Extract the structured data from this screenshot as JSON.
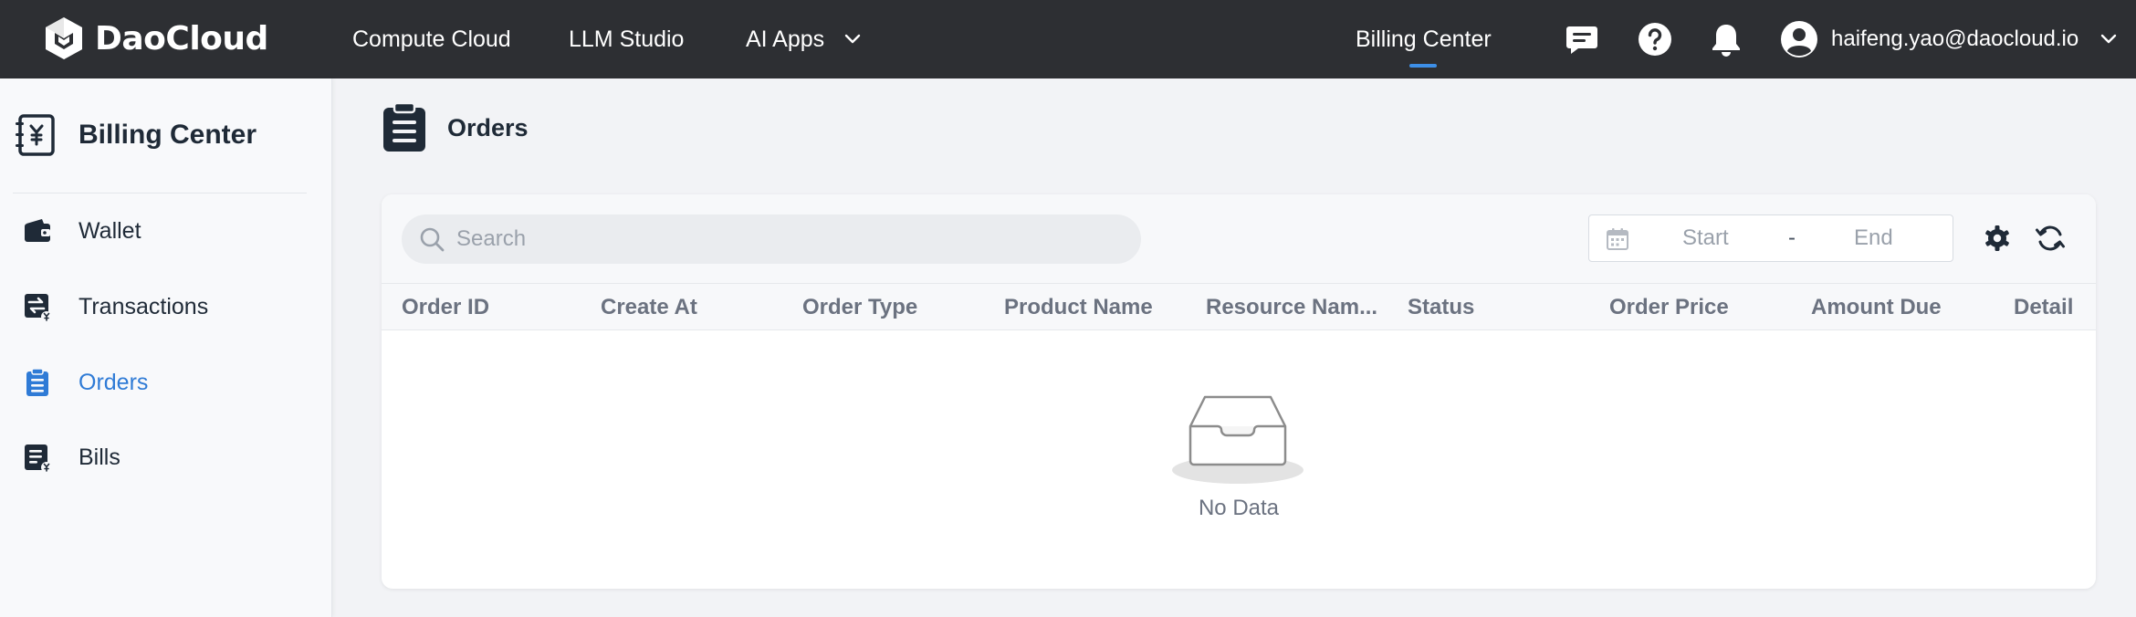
{
  "brand": {
    "name": "DaoCloud"
  },
  "topnav": {
    "items": [
      {
        "label": "Compute Cloud"
      },
      {
        "label": "LLM Studio"
      },
      {
        "label": "AI Apps"
      }
    ],
    "active": {
      "label": "Billing Center"
    },
    "icons": [
      "chat-icon",
      "help-icon",
      "bell-icon"
    ],
    "user": {
      "email": "haifeng.yao@daocloud.io"
    }
  },
  "sidebar": {
    "title": "Billing Center",
    "items": [
      {
        "label": "Wallet",
        "icon": "wallet-icon"
      },
      {
        "label": "Transactions",
        "icon": "transactions-icon"
      },
      {
        "label": "Orders",
        "icon": "orders-icon",
        "active": true
      },
      {
        "label": "Bills",
        "icon": "bills-icon"
      }
    ]
  },
  "main": {
    "title": "Orders",
    "search": {
      "placeholder": "Search",
      "value": ""
    },
    "daterange": {
      "start_placeholder": "Start",
      "separator": "-",
      "end_placeholder": "End"
    },
    "table": {
      "columns": [
        "Order ID",
        "Create At",
        "Order Type",
        "Product Name",
        "Resource Nam...",
        "Status",
        "Order Price",
        "Amount Due",
        "Detail"
      ],
      "rows": [],
      "empty_text": "No Data"
    }
  },
  "colors": {
    "topbar": "#2d2f33",
    "accent": "#2f7bd6",
    "active_indicator": "#3d8fe8",
    "icon_dark": "#1f2a37"
  }
}
